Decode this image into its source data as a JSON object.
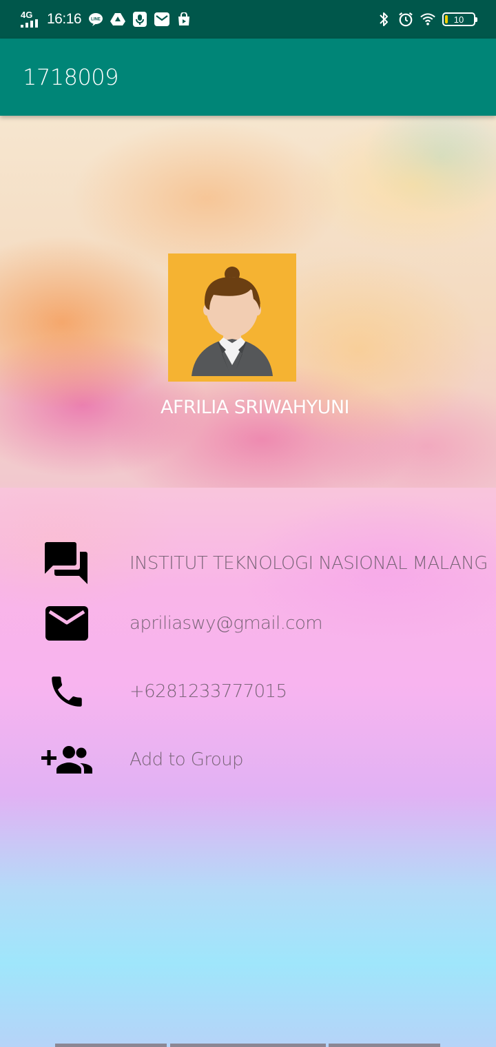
{
  "status_bar": {
    "network": "4G",
    "time": "16:16",
    "battery": "10",
    "battery_level": 0.1,
    "left_icons": [
      "signal-icon",
      "line-app-icon",
      "drive-icon",
      "recorder-icon",
      "mail-icon",
      "store-icon"
    ],
    "right_icons": [
      "bluetooth-icon",
      "alarm-icon",
      "wifi-icon",
      "battery-icon"
    ]
  },
  "app_bar": {
    "title": "1718009"
  },
  "profile": {
    "name": "AFRILIA SRIWAHYUNI"
  },
  "details": [
    {
      "icon": "chat-icon",
      "text": "INSTITUT TEKNOLOGI NASIONAL MALANG"
    },
    {
      "icon": "email-icon",
      "text": "apriliaswy@gmail.com"
    },
    {
      "icon": "phone-icon",
      "text": "+6281233777015"
    },
    {
      "icon": "group-add-icon",
      "text": "Add to Group"
    }
  ],
  "colors": {
    "status_bar": "#00574b",
    "app_bar": "#008577",
    "avatar_background": "#f5b332",
    "detail_text": "#7a6478"
  }
}
